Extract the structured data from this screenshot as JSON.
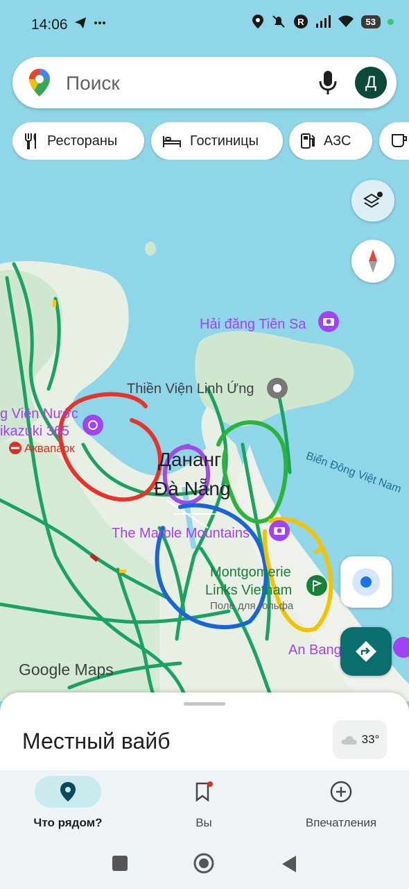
{
  "status_bar": {
    "time": "14:06",
    "battery": "53"
  },
  "search": {
    "placeholder": "Поиск",
    "avatar_letter": "Д"
  },
  "chips": [
    {
      "label": "Рестораны",
      "icon": "fork-knife-icon"
    },
    {
      "label": "Гостиницы",
      "icon": "bed-icon"
    },
    {
      "label": "АЗС",
      "icon": "gas-pump-icon"
    },
    {
      "label": "",
      "icon": "coffee-cup-icon"
    }
  ],
  "map": {
    "labels": {
      "lighthouse": "Hải đăng Tiên Sa",
      "pagoda": "Thiền Viện Linh Ứng",
      "water_park_1": "g Viên Nước",
      "water_park_2": "ikazuki 365",
      "aqua_park": "Аквапарк",
      "city_ru": "Дананг",
      "city_vi": "Đà Nẵng",
      "sea": "Biển Đông Việt Nam",
      "marble": "The Marble Mountains",
      "golf_1": "Montgomerie",
      "golf_2": "Links Vietnam",
      "golf_3": "Поле для гольфа",
      "an_bang": "An Bang",
      "logo": "Google Maps"
    },
    "colors": {
      "water": "#8fd6e9",
      "land": "#e8f0e6",
      "road": "#1aa260",
      "poi": "#a142f4"
    }
  },
  "sheet": {
    "title": "Местный вайб",
    "temperature": "33°"
  },
  "bottom_nav": [
    {
      "label": "Что рядом?",
      "icon": "location-pin-icon",
      "active": true
    },
    {
      "label": "Вы",
      "icon": "bookmark-icon",
      "active": false
    },
    {
      "label": "Впечатления",
      "icon": "plus-circle-icon",
      "active": false
    }
  ]
}
